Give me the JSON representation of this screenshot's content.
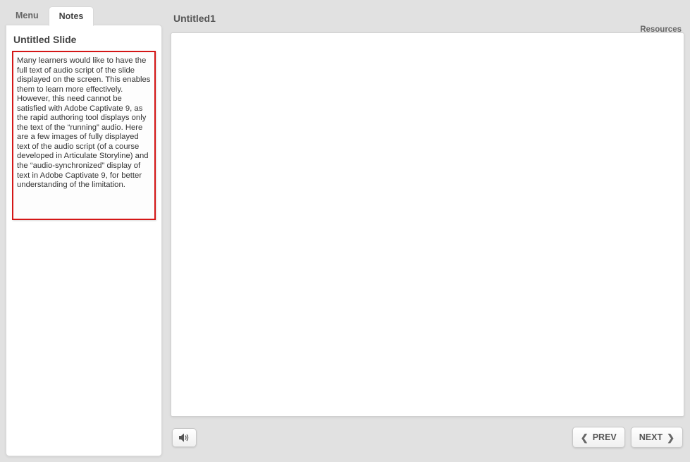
{
  "tabs": {
    "menu": "Menu",
    "notes": "Notes",
    "active": "notes"
  },
  "sidebar": {
    "slide_title": "Untitled Slide",
    "notes_text": "Many learners would like to have the full text of audio script of the slide displayed on the screen. This enables them to learn more effectively. However, this need cannot be satisfied with Adobe Captivate 9, as the rapid authoring tool displays only the text of the “running” audio. Here are a few images of fully displayed text of the audio script (of a course developed in Articulate Storyline) and the “audio-synchronized” display of text in Adobe Captivate 9, for better understanding of the limitation."
  },
  "header": {
    "page_title": "Untitled1",
    "resources_label": "Resources"
  },
  "controls": {
    "audio_icon": "audio",
    "prev_label": "PREV",
    "next_label": "NEXT"
  }
}
